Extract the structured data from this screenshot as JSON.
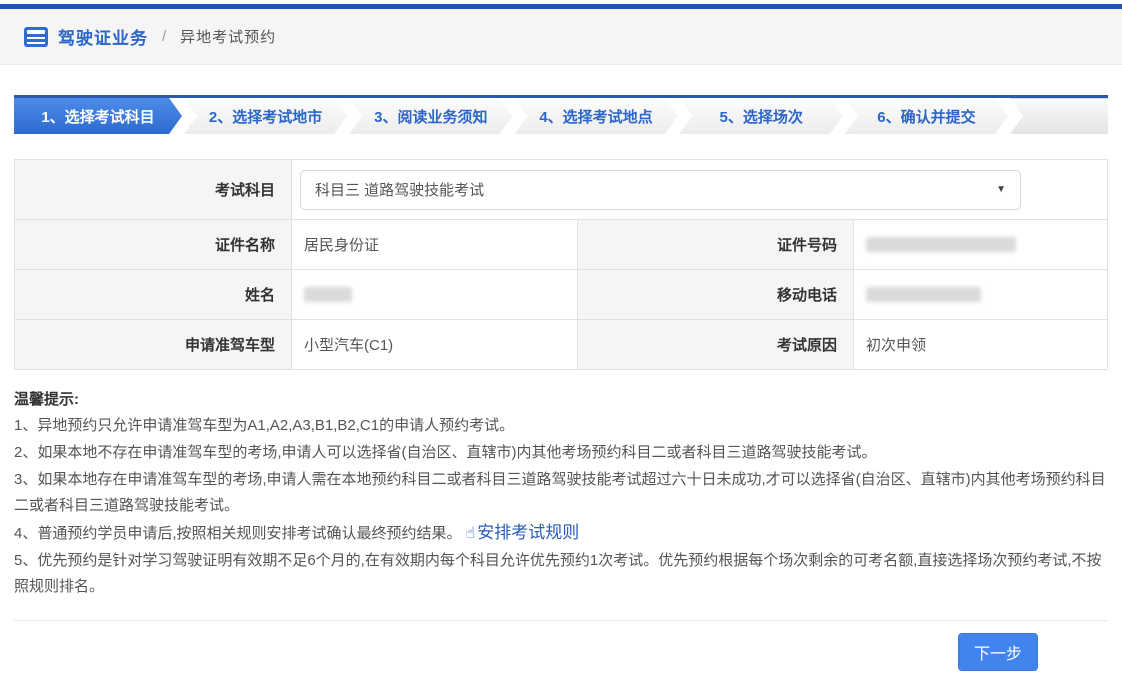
{
  "breadcrumb": {
    "section": "驾驶证业务",
    "separator": "/",
    "page": "异地考试预约"
  },
  "steps": {
    "items": [
      {
        "label": "1、选择考试科目",
        "active": true
      },
      {
        "label": "2、选择考试地市",
        "active": false
      },
      {
        "label": "3、阅读业务须知",
        "active": false
      },
      {
        "label": "4、选择考试地点",
        "active": false
      },
      {
        "label": "5、选择场次",
        "active": false
      },
      {
        "label": "6、确认并提交",
        "active": false
      }
    ]
  },
  "form": {
    "exam_subject": {
      "label": "考试科目",
      "value": "科目三 道路驾驶技能考试"
    },
    "id_type": {
      "label": "证件名称",
      "value": "居民身份证"
    },
    "id_number": {
      "label": "证件号码",
      "masked": true
    },
    "name": {
      "label": "姓名",
      "masked": true
    },
    "phone": {
      "label": "移动电话",
      "masked": true
    },
    "vehicle_type": {
      "label": "申请准驾车型",
      "value": "小型汽车(C1)"
    },
    "exam_reason": {
      "label": "考试原因",
      "value": "初次申领"
    }
  },
  "tips": {
    "title": "温馨提示:",
    "item1": "1、异地预约只允许申请准驾车型为A1,A2,A3,B1,B2,C1的申请人预约考试。",
    "item2": "2、如果本地不存在申请准驾车型的考场,申请人可以选择省(自治区、直辖市)内其他考场预约科目二或者科目三道路驾驶技能考试。",
    "item3": "3、如果本地存在申请准驾车型的考场,申请人需在本地预约科目二或者科目三道路驾驶技能考试超过六十日未成功,才可以选择省(自治区、直辖市)内其他考场预约科目二或者科目三道路驾驶技能考试。",
    "item4_text": "4、普通预约学员申请后,按照相关规则安排考试确认最终预约结果。",
    "item4_link": "安排考试规则",
    "item5": "5、优先预约是针对学习驾驶证明有效期不足6个月的,在有效期内每个科目允许优先预约1次考试。优先预约根据每个场次剩余的可考名额,直接选择场次预约考试,不按照规则排名。"
  },
  "icons": {
    "dropdown_arrow": "▼",
    "link_hand": "☝"
  },
  "footer": {
    "next_label": "下一步"
  }
}
